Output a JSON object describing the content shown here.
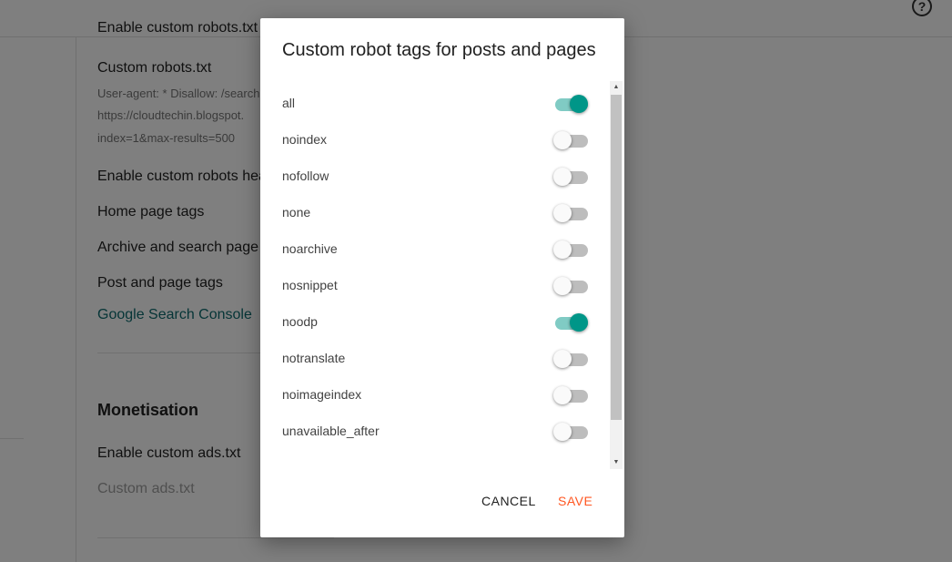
{
  "background": {
    "cut_off_text": "Enable custom robots.txt",
    "custom_robots_label": "Custom robots.txt",
    "custom_robots_value_lines": [
      "User-agent: * Disallow: /search",
      "https://cloudtechin.blogspot.",
      "index=1&max-results=500"
    ],
    "enable_custom_robots_header": "Enable custom robots header tags",
    "home_page_tags": "Home page tags",
    "archive_search_tags": "Archive and search page tags",
    "post_page_tags": "Post and page tags",
    "search_console_link": "Google Search Console",
    "monetisation_title": "Monetisation",
    "enable_custom_ads": "Enable custom ads.txt",
    "custom_ads": "Custom ads.txt"
  },
  "dialog": {
    "title": "Custom robot tags for posts and pages",
    "options": [
      {
        "label": "all",
        "checked": true
      },
      {
        "label": "noindex",
        "checked": false
      },
      {
        "label": "nofollow",
        "checked": false
      },
      {
        "label": "none",
        "checked": false
      },
      {
        "label": "noarchive",
        "checked": false
      },
      {
        "label": "nosnippet",
        "checked": false
      },
      {
        "label": "noodp",
        "checked": true
      },
      {
        "label": "notranslate",
        "checked": false
      },
      {
        "label": "noimageindex",
        "checked": false
      },
      {
        "label": "unavailable_after",
        "checked": false
      }
    ],
    "cancel_label": "CANCEL",
    "save_label": "SAVE"
  },
  "colors": {
    "accent": "#009688",
    "save": "#ff5722",
    "link": "#0c6b6e"
  },
  "icons": {
    "help": "help-circle-icon"
  }
}
